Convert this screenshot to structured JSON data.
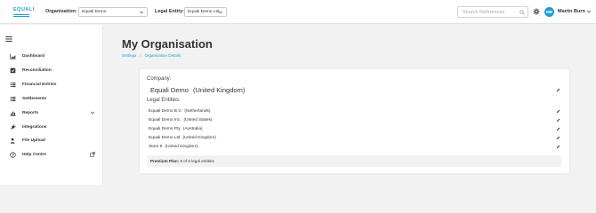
{
  "header": {
    "logo_text": "EQUALI",
    "organisation_label": "Organisation:",
    "organisation_value": "Equali Demo",
    "legal_entity_label": "Legal Entity:",
    "legal_entity_value": "Equali Demo Ltd",
    "search_placeholder": "Search References",
    "user_initials": "MB",
    "user_name": "Martin Burn"
  },
  "sidebar": {
    "items": [
      {
        "label": "Dashboard",
        "icon": "chart-icon"
      },
      {
        "label": "Reconciliation",
        "icon": "checkbox-icon"
      },
      {
        "label": "Financial Entries",
        "icon": "list-icon"
      },
      {
        "label": "Settlements",
        "icon": "list-icon"
      },
      {
        "label": "Reports",
        "icon": "bar-chart-icon"
      },
      {
        "label": "Integrations",
        "icon": "plug-icon"
      },
      {
        "label": "File Upload",
        "icon": "upload-icon"
      },
      {
        "label": "Help Centre",
        "icon": "help-icon"
      }
    ]
  },
  "main": {
    "title": "My Organisation",
    "breadcrumb": [
      "Settings",
      "Organisation Details"
    ],
    "company_label": "Company:",
    "company_name": "Equali Demo",
    "company_country": "(United Kingdom)",
    "entities_label": "Legal Entities:",
    "entities": [
      {
        "name": "Equali Demo B.V.",
        "country": "(Netherlands)"
      },
      {
        "name": "Equali Demo Inc.",
        "country": "(United States)"
      },
      {
        "name": "Equali Demo Pty",
        "country": "(Australia)"
      },
      {
        "name": "Equali Demo Ltd",
        "country": "(United Kingdom)"
      },
      {
        "name": "Store 5",
        "country": "(United Kingdom)"
      }
    ],
    "plan_label": "Premium Plan:",
    "plan_text": "5 of 5 legal entities"
  },
  "colors": {
    "accent": "#1f9bd1"
  }
}
